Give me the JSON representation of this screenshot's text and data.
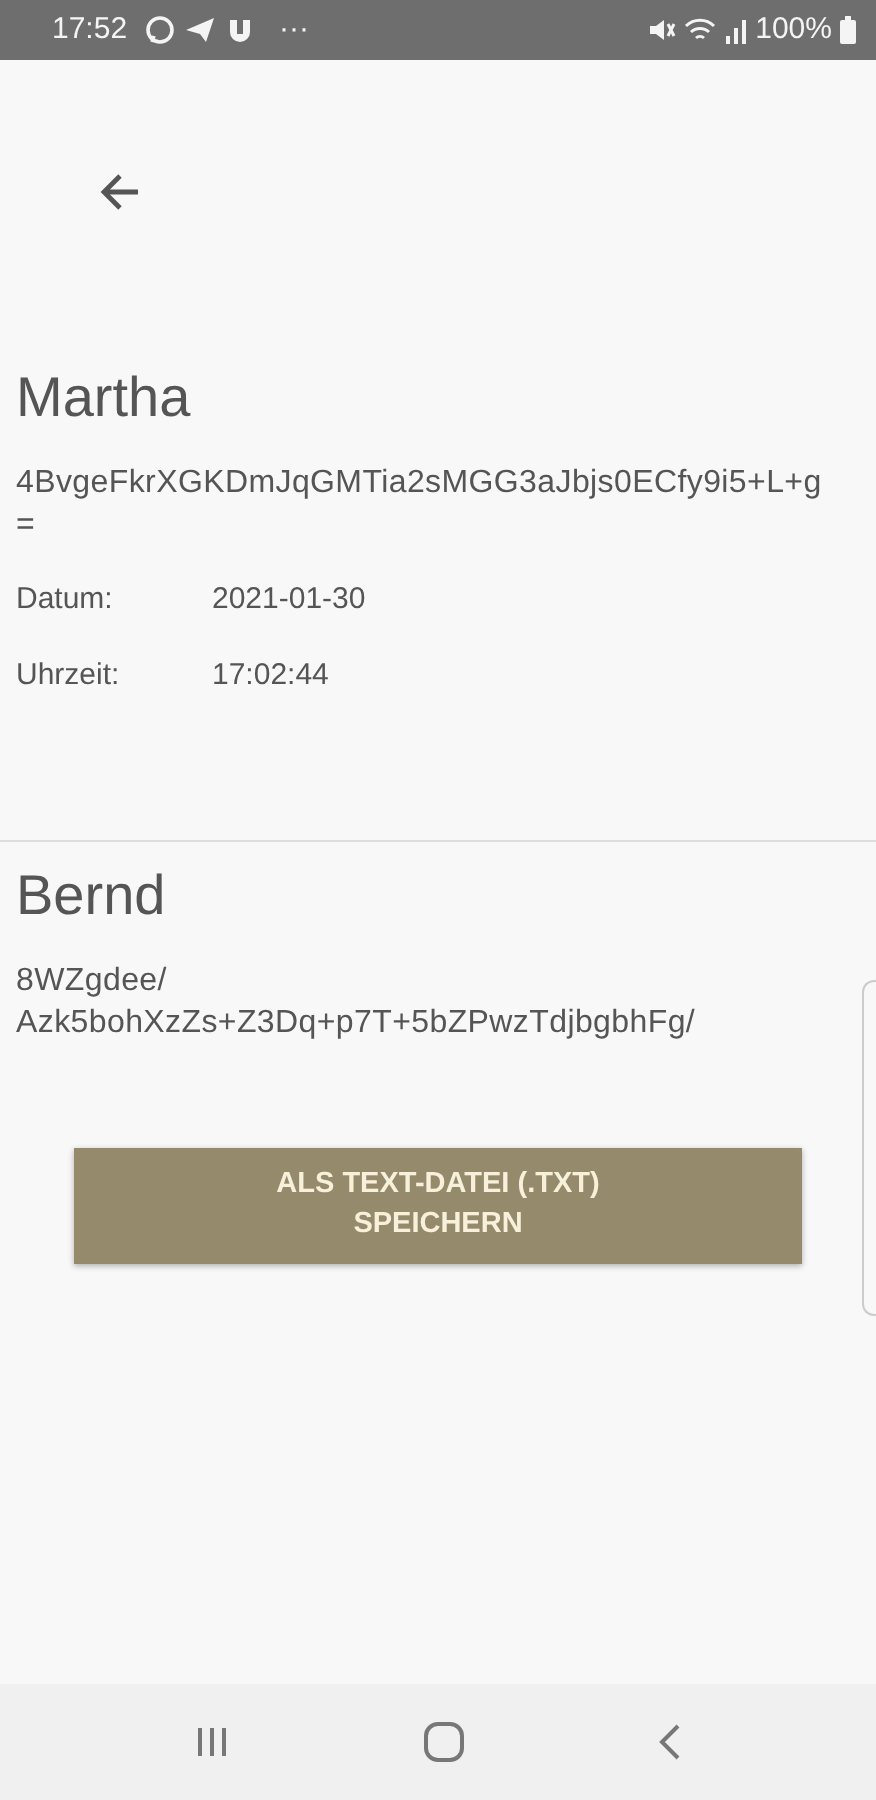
{
  "status_bar": {
    "time": "17:52",
    "more": "···",
    "battery": "100%"
  },
  "entries": [
    {
      "name": "Martha",
      "key": "4BvgeFkrXGKDmJqGMTia2sMGG3aJbjs0ECfy9i5+L+g=",
      "fields": [
        {
          "label": "Datum:",
          "value": "2021-01-30"
        },
        {
          "label": "Uhrzeit:",
          "value": "17:02:44"
        }
      ]
    },
    {
      "name": "Bernd",
      "key": "8WZgdee/ Azk5bohXzZs+Z3Dq+p7T+5bZPwzTdjbgbhFg/"
    }
  ],
  "save_button": {
    "label": "ALS TEXT-DATEI (.TXT) SPEICHERN"
  }
}
